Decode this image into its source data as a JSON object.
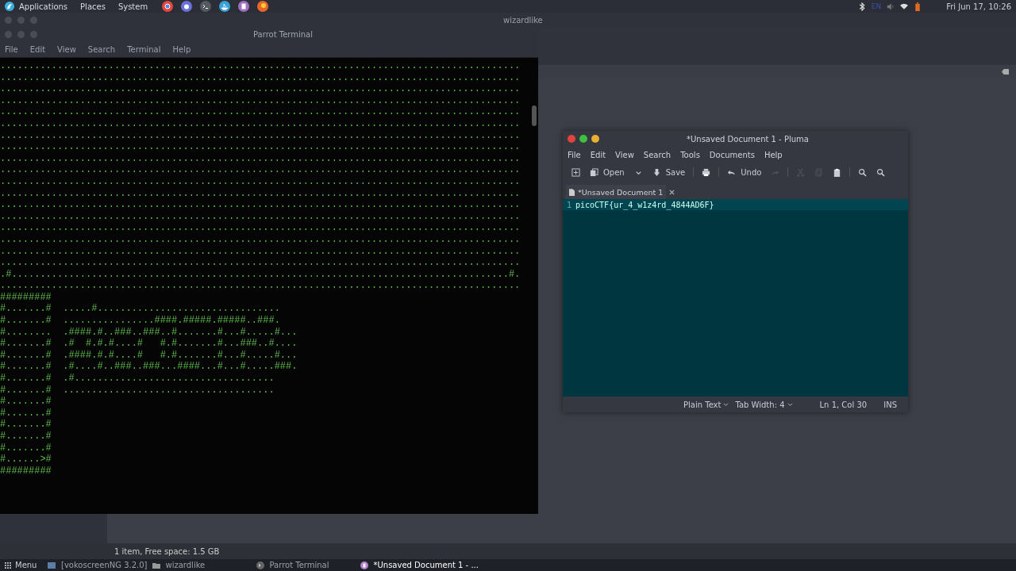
{
  "top_panel": {
    "menus": [
      "Applications",
      "Places",
      "System"
    ],
    "launchers": [
      {
        "kind": "chrome"
      },
      {
        "kind": "discord"
      },
      {
        "kind": "terminal"
      },
      {
        "kind": "ship"
      },
      {
        "kind": "doc"
      },
      {
        "kind": "firefox"
      }
    ],
    "keyboard_layout": "EN",
    "clock": "Fri Jun 17, 10:26"
  },
  "file_manager": {
    "title": "wizardlike",
    "status": "1 item, Free space: 1.5 GB"
  },
  "terminal": {
    "title": "Parrot Terminal",
    "menu": [
      "File",
      "Edit",
      "View",
      "Search",
      "Terminal",
      "Help"
    ],
    "lines": [
      "...........................................................................................",
      "...........................................................................................",
      "...........................................................................................",
      "...........................................................................................",
      "...........................................................................................",
      "...........................................................................................",
      "...........................................................................................",
      "...........................................................................................",
      "...........................................................................................",
      "...........................................................................................",
      "...........................................................................................",
      "...........................................................................................",
      "...........................................................................................",
      "...........................................................................................",
      "...........................................................................................",
      "...........................................................................................",
      "...........................................................................................",
      "...........................................................................................",
      ".#.......................................................................................#.",
      "...........................................................................................",
      "#########",
      "#.......#  .....#................................",
      "#.......#  ................####.#####.#####..###.",
      "#........  .####.#..###..###..#.......#...#.....#...",
      "#.......#  .#  #.#.#....#   #.#.......#...###..#....",
      "#.......#  .####.#.#....#   #.#.......#...#.....#...",
      "#.......#  .#....#..###..###...####...#...#.....###.",
      "#.......#  .#...................................",
      "#.......#  .....................................",
      "#.......#",
      "#.......#",
      "#.......#",
      "#.......#",
      "#.......#",
      "#......>#",
      "#########"
    ]
  },
  "editor": {
    "title": "*Unsaved Document 1 - Pluma",
    "menu": [
      "File",
      "Edit",
      "View",
      "Search",
      "Tools",
      "Documents",
      "Help"
    ],
    "toolbar": [
      {
        "kind": "new",
        "disabled": false
      },
      {
        "kind": "open",
        "label": "Open",
        "disabled": false
      },
      {
        "kind": "dropdown",
        "disabled": false
      },
      {
        "kind": "save",
        "label": "Save",
        "disabled": false
      },
      {
        "kind": "separator"
      },
      {
        "kind": "print",
        "disabled": false
      },
      {
        "kind": "separator"
      },
      {
        "kind": "undo",
        "label": "Undo",
        "disabled": false
      },
      {
        "kind": "redo",
        "disabled": true
      },
      {
        "kind": "separator"
      },
      {
        "kind": "cut",
        "disabled": true
      },
      {
        "kind": "copy",
        "disabled": true
      },
      {
        "kind": "paste",
        "disabled": false
      },
      {
        "kind": "separator"
      },
      {
        "kind": "find",
        "disabled": false
      },
      {
        "kind": "replace",
        "disabled": false
      }
    ],
    "tab": "*Unsaved Document 1",
    "lines": [
      {
        "number": "1",
        "text": "picoCTF{ur_4_w1z4rd_4844AD6F}"
      }
    ],
    "status": {
      "language": "Plain Text",
      "tab_width": "Tab Width: 4",
      "position": "Ln 1, Col 30",
      "mode": "INS"
    }
  },
  "taskbar": {
    "menu": "Menu",
    "items": [
      {
        "kind": "app",
        "label": "[vokoscreenNG 3.2.0]",
        "selected": false
      },
      {
        "kind": "folder",
        "label": "wizardlike",
        "selected": false
      },
      {
        "kind": "terminal",
        "label": "Parrot Terminal",
        "selected": false
      },
      {
        "kind": "editor",
        "label": "*Unsaved Document 1 - ...",
        "selected": true
      }
    ]
  }
}
